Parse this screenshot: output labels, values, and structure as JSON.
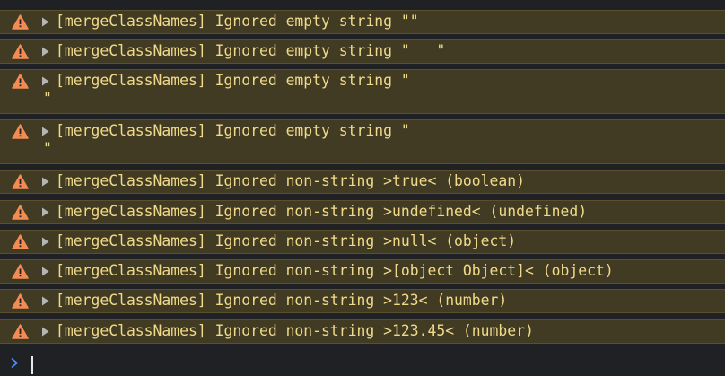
{
  "colors": {
    "background": "#202124",
    "warning_row_bg": "#413b23",
    "warning_row_border": "#5a5030",
    "warning_text": "#f0d98a",
    "warning_icon": "#f28b54",
    "arrow": "#b5b5b5",
    "prompt_chevron": "#4d90fe",
    "caret": "#e8eaed"
  },
  "console": {
    "prompt": {
      "icon": "chevron-right-icon",
      "input_value": ""
    },
    "messages": [
      {
        "level": "warning",
        "icon": "warning-icon",
        "expand_icon": "expand-triangle-icon",
        "text": "[mergeClassNames] Ignored empty string \"\""
      },
      {
        "level": "warning",
        "icon": "warning-icon",
        "expand_icon": "expand-triangle-icon",
        "text": "[mergeClassNames] Ignored empty string \"   \""
      },
      {
        "level": "warning",
        "icon": "warning-icon",
        "expand_icon": "expand-triangle-icon",
        "text": "[mergeClassNames] Ignored empty string \"\n\""
      },
      {
        "level": "warning",
        "icon": "warning-icon",
        "expand_icon": "expand-triangle-icon",
        "text": "[mergeClassNames] Ignored empty string \"\n\""
      },
      {
        "level": "warning",
        "icon": "warning-icon",
        "expand_icon": "expand-triangle-icon",
        "text": "[mergeClassNames] Ignored non-string >true< (boolean)"
      },
      {
        "level": "warning",
        "icon": "warning-icon",
        "expand_icon": "expand-triangle-icon",
        "text": "[mergeClassNames] Ignored non-string >undefined< (undefined)"
      },
      {
        "level": "warning",
        "icon": "warning-icon",
        "expand_icon": "expand-triangle-icon",
        "text": "[mergeClassNames] Ignored non-string >null< (object)"
      },
      {
        "level": "warning",
        "icon": "warning-icon",
        "expand_icon": "expand-triangle-icon",
        "text": "[mergeClassNames] Ignored non-string >[object Object]< (object)"
      },
      {
        "level": "warning",
        "icon": "warning-icon",
        "expand_icon": "expand-triangle-icon",
        "text": "[mergeClassNames] Ignored non-string >123< (number)"
      },
      {
        "level": "warning",
        "icon": "warning-icon",
        "expand_icon": "expand-triangle-icon",
        "text": "[mergeClassNames] Ignored non-string >123.45< (number)"
      }
    ]
  }
}
